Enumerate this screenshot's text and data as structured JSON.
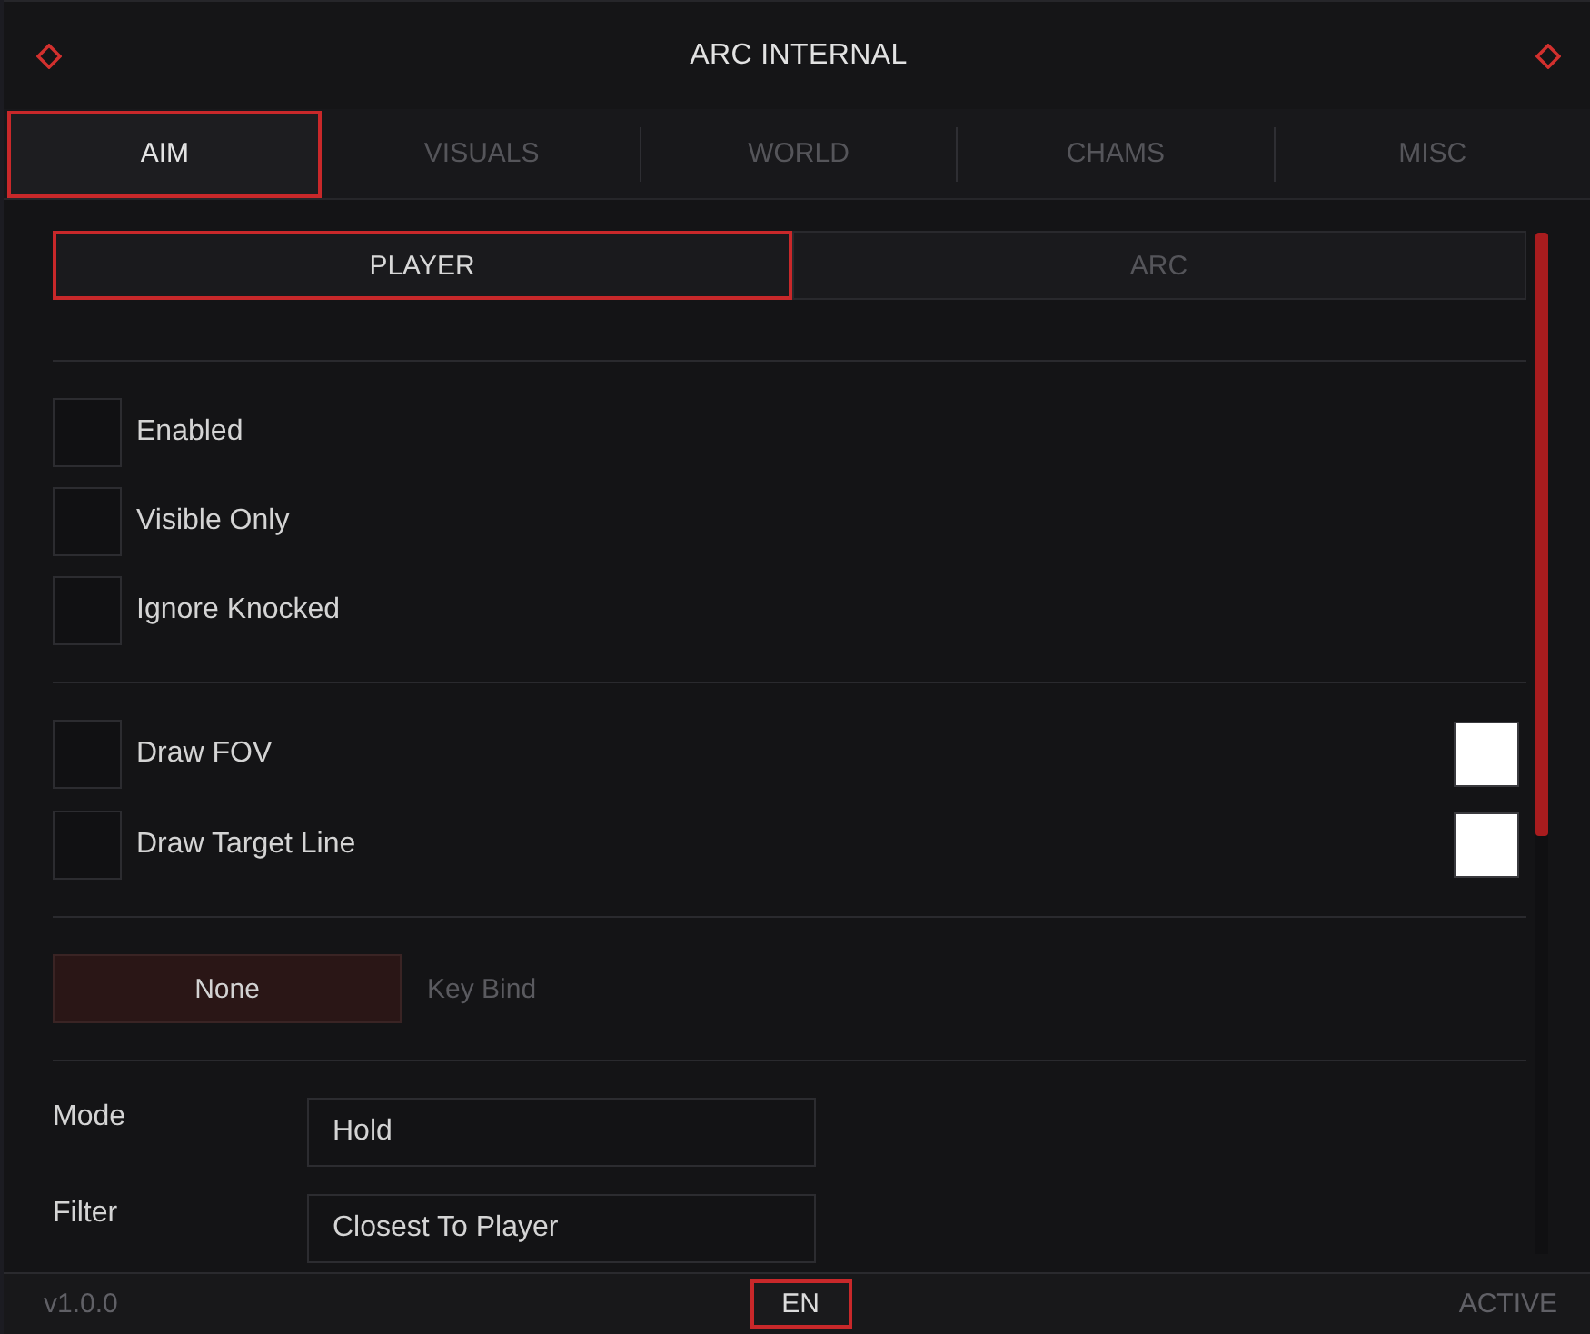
{
  "window": {
    "title": "ARC INTERNAL"
  },
  "tabs": [
    {
      "label": "AIM",
      "selected": true
    },
    {
      "label": "VISUALS",
      "selected": false
    },
    {
      "label": "WORLD",
      "selected": false
    },
    {
      "label": "CHAMS",
      "selected": false
    },
    {
      "label": "MISC",
      "selected": false
    }
  ],
  "sub_tabs": [
    {
      "label": "PLAYER",
      "selected": true
    },
    {
      "label": "ARC",
      "selected": false
    }
  ],
  "sections": [
    {
      "kind": "checkboxes",
      "items": [
        {
          "label": "Enabled",
          "checked": false
        },
        {
          "label": "Visible Only",
          "checked": false
        },
        {
          "label": "Ignore Knocked",
          "checked": false
        }
      ]
    },
    {
      "kind": "checkboxes",
      "items": [
        {
          "label": "Draw FOV",
          "checked": false,
          "color": "#ffffff"
        },
        {
          "label": "Draw Target Line",
          "checked": false,
          "color": "#ffffff"
        }
      ]
    },
    {
      "kind": "keybind",
      "button": "None",
      "label": "Key Bind"
    },
    {
      "kind": "selects",
      "items": [
        {
          "label": "Mode",
          "value": "Hold"
        },
        {
          "label": "Filter",
          "value": "Closest To Player"
        }
      ]
    }
  ],
  "status_bar": {
    "version": "v1.0.0",
    "language": "EN",
    "status": "ACTIVE"
  }
}
